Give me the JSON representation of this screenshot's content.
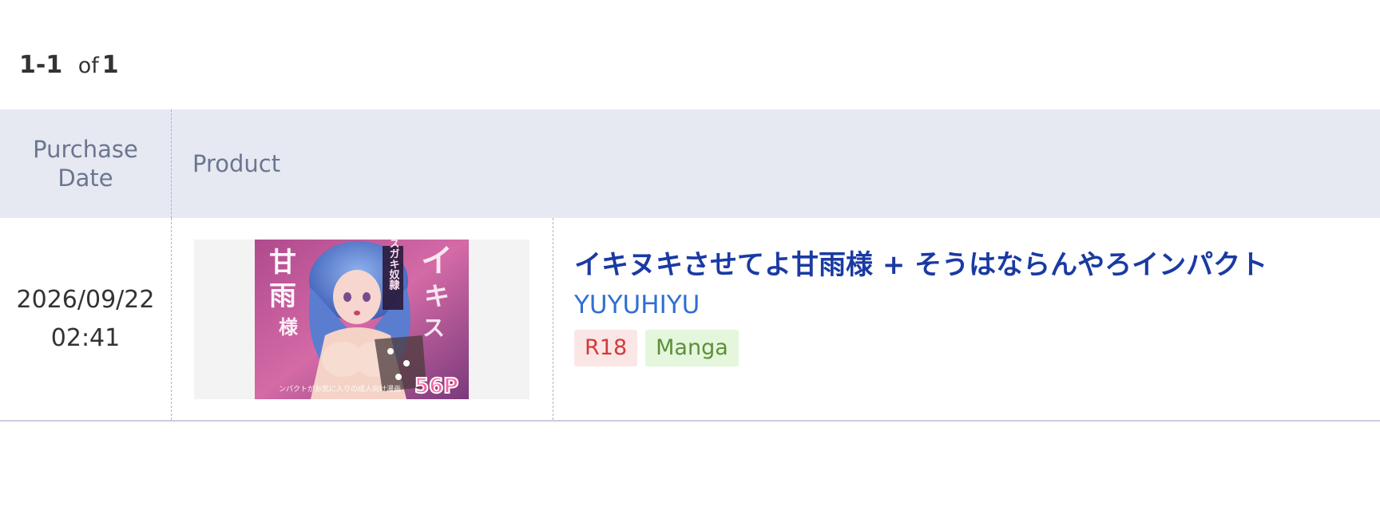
{
  "pagination": {
    "range": "1-1",
    "of_label": "of",
    "total": "1"
  },
  "table": {
    "headers": {
      "purchase_date_line1": "Purchase",
      "purchase_date_line2": "Date",
      "product": "Product"
    },
    "rows": [
      {
        "date": "2026/09/22",
        "time": "02:41",
        "title": "イキヌキさせてよ甘雨様 + そうはならんやろインパクト",
        "circle": "YUYUHIYU",
        "tags": [
          "R18",
          "Manga"
        ],
        "cover": {
          "title_text": "イキヌキさせて甘雨様",
          "banner_text": "メスガキ奴隷",
          "pages_text": "56P"
        }
      }
    ]
  },
  "colors": {
    "header_bg": "#e6e9f2",
    "title_link": "#1a3aa3",
    "circle_link": "#2f6fd1",
    "tag_r18_text": "#d23a3a",
    "tag_manga_text": "#5d8f38"
  }
}
